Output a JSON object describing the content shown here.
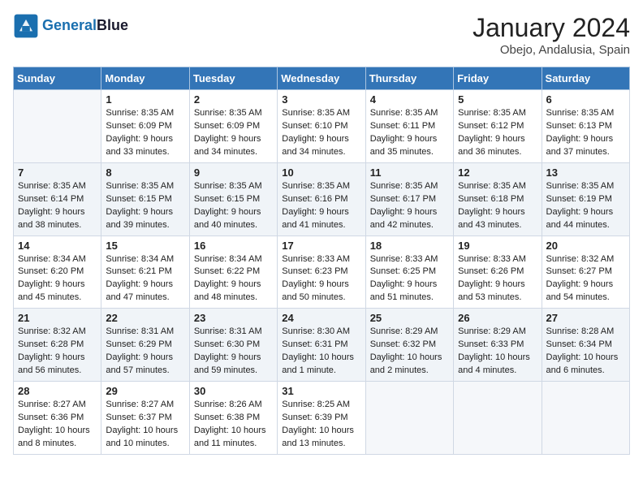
{
  "header": {
    "logo_text1": "General",
    "logo_text2": "Blue",
    "month": "January 2024",
    "location": "Obejo, Andalusia, Spain"
  },
  "weekdays": [
    "Sunday",
    "Monday",
    "Tuesday",
    "Wednesday",
    "Thursday",
    "Friday",
    "Saturday"
  ],
  "weeks": [
    [
      {
        "day": "",
        "sunrise": "",
        "sunset": "",
        "daylight": ""
      },
      {
        "day": "1",
        "sunrise": "Sunrise: 8:35 AM",
        "sunset": "Sunset: 6:09 PM",
        "daylight": "Daylight: 9 hours and 33 minutes."
      },
      {
        "day": "2",
        "sunrise": "Sunrise: 8:35 AM",
        "sunset": "Sunset: 6:09 PM",
        "daylight": "Daylight: 9 hours and 34 minutes."
      },
      {
        "day": "3",
        "sunrise": "Sunrise: 8:35 AM",
        "sunset": "Sunset: 6:10 PM",
        "daylight": "Daylight: 9 hours and 34 minutes."
      },
      {
        "day": "4",
        "sunrise": "Sunrise: 8:35 AM",
        "sunset": "Sunset: 6:11 PM",
        "daylight": "Daylight: 9 hours and 35 minutes."
      },
      {
        "day": "5",
        "sunrise": "Sunrise: 8:35 AM",
        "sunset": "Sunset: 6:12 PM",
        "daylight": "Daylight: 9 hours and 36 minutes."
      },
      {
        "day": "6",
        "sunrise": "Sunrise: 8:35 AM",
        "sunset": "Sunset: 6:13 PM",
        "daylight": "Daylight: 9 hours and 37 minutes."
      }
    ],
    [
      {
        "day": "7",
        "sunrise": "Sunrise: 8:35 AM",
        "sunset": "Sunset: 6:14 PM",
        "daylight": "Daylight: 9 hours and 38 minutes."
      },
      {
        "day": "8",
        "sunrise": "Sunrise: 8:35 AM",
        "sunset": "Sunset: 6:15 PM",
        "daylight": "Daylight: 9 hours and 39 minutes."
      },
      {
        "day": "9",
        "sunrise": "Sunrise: 8:35 AM",
        "sunset": "Sunset: 6:15 PM",
        "daylight": "Daylight: 9 hours and 40 minutes."
      },
      {
        "day": "10",
        "sunrise": "Sunrise: 8:35 AM",
        "sunset": "Sunset: 6:16 PM",
        "daylight": "Daylight: 9 hours and 41 minutes."
      },
      {
        "day": "11",
        "sunrise": "Sunrise: 8:35 AM",
        "sunset": "Sunset: 6:17 PM",
        "daylight": "Daylight: 9 hours and 42 minutes."
      },
      {
        "day": "12",
        "sunrise": "Sunrise: 8:35 AM",
        "sunset": "Sunset: 6:18 PM",
        "daylight": "Daylight: 9 hours and 43 minutes."
      },
      {
        "day": "13",
        "sunrise": "Sunrise: 8:35 AM",
        "sunset": "Sunset: 6:19 PM",
        "daylight": "Daylight: 9 hours and 44 minutes."
      }
    ],
    [
      {
        "day": "14",
        "sunrise": "Sunrise: 8:34 AM",
        "sunset": "Sunset: 6:20 PM",
        "daylight": "Daylight: 9 hours and 45 minutes."
      },
      {
        "day": "15",
        "sunrise": "Sunrise: 8:34 AM",
        "sunset": "Sunset: 6:21 PM",
        "daylight": "Daylight: 9 hours and 47 minutes."
      },
      {
        "day": "16",
        "sunrise": "Sunrise: 8:34 AM",
        "sunset": "Sunset: 6:22 PM",
        "daylight": "Daylight: 9 hours and 48 minutes."
      },
      {
        "day": "17",
        "sunrise": "Sunrise: 8:33 AM",
        "sunset": "Sunset: 6:23 PM",
        "daylight": "Daylight: 9 hours and 50 minutes."
      },
      {
        "day": "18",
        "sunrise": "Sunrise: 8:33 AM",
        "sunset": "Sunset: 6:25 PM",
        "daylight": "Daylight: 9 hours and 51 minutes."
      },
      {
        "day": "19",
        "sunrise": "Sunrise: 8:33 AM",
        "sunset": "Sunset: 6:26 PM",
        "daylight": "Daylight: 9 hours and 53 minutes."
      },
      {
        "day": "20",
        "sunrise": "Sunrise: 8:32 AM",
        "sunset": "Sunset: 6:27 PM",
        "daylight": "Daylight: 9 hours and 54 minutes."
      }
    ],
    [
      {
        "day": "21",
        "sunrise": "Sunrise: 8:32 AM",
        "sunset": "Sunset: 6:28 PM",
        "daylight": "Daylight: 9 hours and 56 minutes."
      },
      {
        "day": "22",
        "sunrise": "Sunrise: 8:31 AM",
        "sunset": "Sunset: 6:29 PM",
        "daylight": "Daylight: 9 hours and 57 minutes."
      },
      {
        "day": "23",
        "sunrise": "Sunrise: 8:31 AM",
        "sunset": "Sunset: 6:30 PM",
        "daylight": "Daylight: 9 hours and 59 minutes."
      },
      {
        "day": "24",
        "sunrise": "Sunrise: 8:30 AM",
        "sunset": "Sunset: 6:31 PM",
        "daylight": "Daylight: 10 hours and 1 minute."
      },
      {
        "day": "25",
        "sunrise": "Sunrise: 8:29 AM",
        "sunset": "Sunset: 6:32 PM",
        "daylight": "Daylight: 10 hours and 2 minutes."
      },
      {
        "day": "26",
        "sunrise": "Sunrise: 8:29 AM",
        "sunset": "Sunset: 6:33 PM",
        "daylight": "Daylight: 10 hours and 4 minutes."
      },
      {
        "day": "27",
        "sunrise": "Sunrise: 8:28 AM",
        "sunset": "Sunset: 6:34 PM",
        "daylight": "Daylight: 10 hours and 6 minutes."
      }
    ],
    [
      {
        "day": "28",
        "sunrise": "Sunrise: 8:27 AM",
        "sunset": "Sunset: 6:36 PM",
        "daylight": "Daylight: 10 hours and 8 minutes."
      },
      {
        "day": "29",
        "sunrise": "Sunrise: 8:27 AM",
        "sunset": "Sunset: 6:37 PM",
        "daylight": "Daylight: 10 hours and 10 minutes."
      },
      {
        "day": "30",
        "sunrise": "Sunrise: 8:26 AM",
        "sunset": "Sunset: 6:38 PM",
        "daylight": "Daylight: 10 hours and 11 minutes."
      },
      {
        "day": "31",
        "sunrise": "Sunrise: 8:25 AM",
        "sunset": "Sunset: 6:39 PM",
        "daylight": "Daylight: 10 hours and 13 minutes."
      },
      {
        "day": "",
        "sunrise": "",
        "sunset": "",
        "daylight": ""
      },
      {
        "day": "",
        "sunrise": "",
        "sunset": "",
        "daylight": ""
      },
      {
        "day": "",
        "sunrise": "",
        "sunset": "",
        "daylight": ""
      }
    ]
  ]
}
